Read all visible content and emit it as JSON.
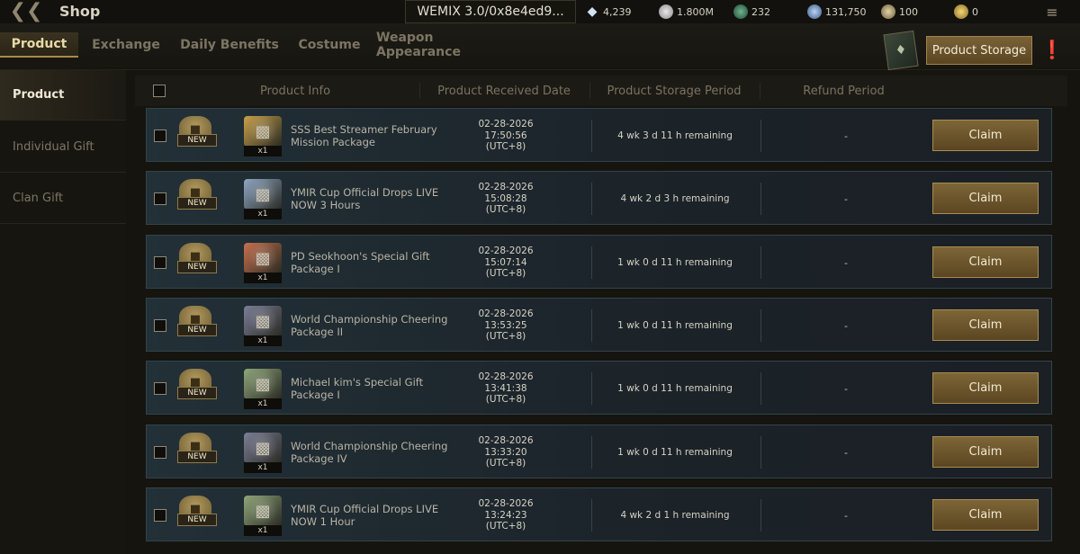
{
  "topbar": {
    "title": "Shop",
    "wallet": "WEMIX 3.0/0x8e4ed9...",
    "currencies": [
      {
        "icon": "diamond-icon",
        "value": "4,239"
      },
      {
        "icon": "silver-coin-icon",
        "value": "1.800M"
      },
      {
        "icon": "green-gem-icon",
        "value": "232"
      },
      {
        "icon": "blue-orb-icon",
        "value": "131,750"
      },
      {
        "icon": "bronze-coin-icon",
        "value": "100"
      },
      {
        "icon": "gold-coin-icon",
        "value": "0"
      }
    ]
  },
  "tabs": [
    {
      "label": "Product",
      "active": true
    },
    {
      "label": "Exchange",
      "active": false
    },
    {
      "label": "Daily Benefits",
      "active": false
    },
    {
      "label": "Costume",
      "active": false
    },
    {
      "label": "Weapon Appearance",
      "active": false
    }
  ],
  "storage_button": "Product Storage",
  "sidebar": [
    {
      "label": "Product",
      "active": true
    },
    {
      "label": "Individual Gift",
      "active": false
    },
    {
      "label": "Clan Gift",
      "active": false
    }
  ],
  "columns": {
    "info": "Product Info",
    "date": "Product Received Date",
    "period": "Product Storage Period",
    "refund": "Refund Period"
  },
  "rows": [
    {
      "badge": "NEW",
      "qty": "x1",
      "name": "SSS Best Streamer February Mission Package",
      "date": "02-28-2026",
      "time": "17:50:56",
      "tz": "(UTC+8)",
      "period": "4 wk 3 d 11 h remaining",
      "refund": "-",
      "action": "Claim",
      "icon_color": "#c9a24a"
    },
    {
      "badge": "NEW",
      "qty": "x1",
      "name": "YMIR Cup Official Drops LIVE NOW 3 Hours",
      "date": "02-28-2026",
      "time": "15:08:28",
      "tz": "(UTC+8)",
      "period": "4 wk 2 d 3 h remaining",
      "refund": "-",
      "action": "Claim",
      "icon_color": "#8fa7c4"
    },
    {
      "badge": "NEW",
      "qty": "x1",
      "name": "PD Seokhoon's Special Gift Package I",
      "date": "02-28-2026",
      "time": "15:07:14",
      "tz": "(UTC+8)",
      "period": "1 wk 0 d 11 h remaining",
      "refund": "-",
      "action": "Claim",
      "icon_color": "#c7714e"
    },
    {
      "badge": "NEW",
      "qty": "x1",
      "name": "World Championship Cheering Package II",
      "date": "02-28-2026",
      "time": "13:53:25",
      "tz": "(UTC+8)",
      "period": "1 wk 0 d 11 h remaining",
      "refund": "-",
      "action": "Claim",
      "icon_color": "#7c7f99"
    },
    {
      "badge": "NEW",
      "qty": "x1",
      "name": "Michael kim's Special Gift Package I",
      "date": "02-28-2026",
      "time": "13:41:38",
      "tz": "(UTC+8)",
      "period": "1 wk 0 d 11 h remaining",
      "refund": "-",
      "action": "Claim",
      "icon_color": "#8fa77a"
    },
    {
      "badge": "NEW",
      "qty": "x1",
      "name": "World Championship Cheering Package IV",
      "date": "02-28-2026",
      "time": "13:33:20",
      "tz": "(UTC+8)",
      "period": "1 wk 0 d 11 h remaining",
      "refund": "-",
      "action": "Claim",
      "icon_color": "#7c7f99"
    },
    {
      "badge": "NEW",
      "qty": "x1",
      "name": "YMIR Cup Official Drops LIVE NOW 1 Hour",
      "date": "02-28-2026",
      "time": "13:24:23",
      "tz": "(UTC+8)",
      "period": "4 wk 2 d 1 h remaining",
      "refund": "-",
      "action": "Claim",
      "icon_color": "#8fa77a"
    }
  ]
}
